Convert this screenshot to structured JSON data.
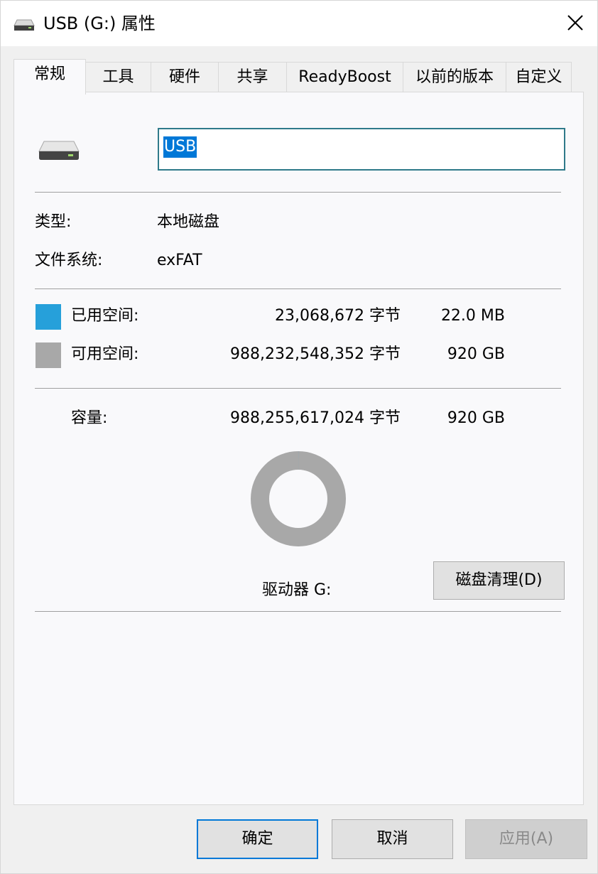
{
  "window": {
    "title": "USB (G:) 属性"
  },
  "tabs": [
    {
      "label": "常规",
      "active": true
    },
    {
      "label": "工具"
    },
    {
      "label": "硬件"
    },
    {
      "label": "共享"
    },
    {
      "label": "ReadyBoost"
    },
    {
      "label": "以前的版本"
    },
    {
      "label": "自定义"
    }
  ],
  "general": {
    "name_value": "USB",
    "type_label": "类型:",
    "type_value": "本地磁盘",
    "fs_label": "文件系统:",
    "fs_value": "exFAT",
    "used_label": "已用空间:",
    "used_bytes": "23,068,672 字节",
    "used_size": "22.0 MB",
    "free_label": "可用空间:",
    "free_bytes": "988,232,548,352 字节",
    "free_size": "920 GB",
    "capacity_label": "容量:",
    "capacity_bytes": "988,255,617,024 字节",
    "capacity_size": "920 GB",
    "drive_label": "驱动器 G:",
    "cleanup_button": "磁盘清理(D)",
    "used_fraction": 2.33e-05,
    "colors": {
      "used": "#26a0da",
      "free": "#a8a8a8"
    }
  },
  "footer": {
    "ok": "确定",
    "cancel": "取消",
    "apply": "应用(A)"
  }
}
